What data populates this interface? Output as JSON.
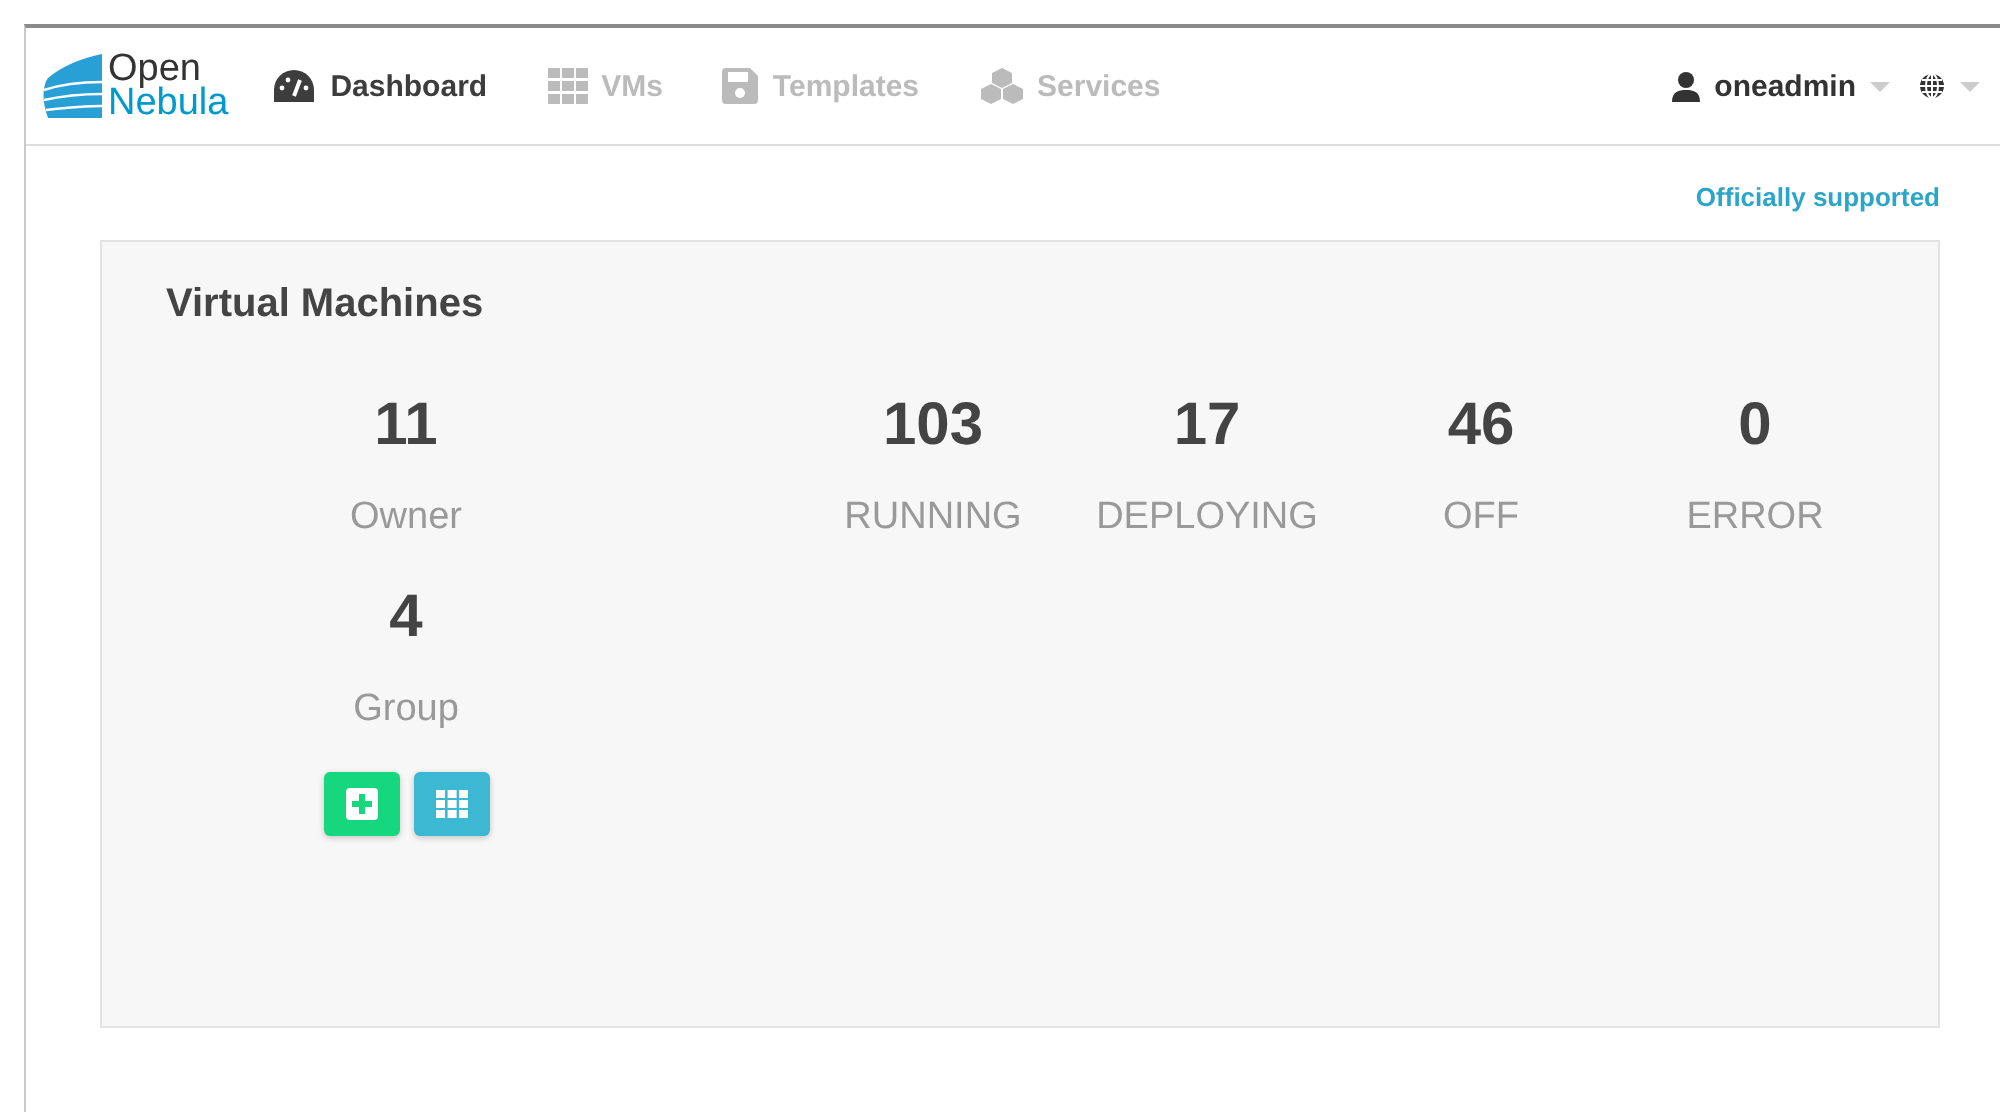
{
  "brand": {
    "line_1": "Open",
    "line_2": "Nebula"
  },
  "nav": [
    {
      "label": "Dashboard",
      "kind": "dashboard",
      "selected": true
    },
    {
      "label": "VMs",
      "kind": "vms",
      "selected": false
    },
    {
      "label": "Templates",
      "kind": "templates",
      "selected": false
    },
    {
      "label": "Services",
      "kind": "services",
      "selected": false
    }
  ],
  "user": {
    "name": "oneadmin"
  },
  "support_link": "Officially supported",
  "card": {
    "title": "Virtual Machines",
    "user_stats": [
      {
        "value": "11",
        "label": "Owner"
      },
      {
        "value": "4",
        "label": "Group"
      }
    ],
    "state_stats": [
      {
        "value": "103",
        "label": "RUNNING"
      },
      {
        "value": "17",
        "label": "DEPLOYING"
      },
      {
        "value": "46",
        "label": "OFF"
      },
      {
        "value": "0",
        "label": "ERROR"
      }
    ],
    "buttons": [
      {
        "kind": "create"
      },
      {
        "kind": "list"
      }
    ]
  }
}
